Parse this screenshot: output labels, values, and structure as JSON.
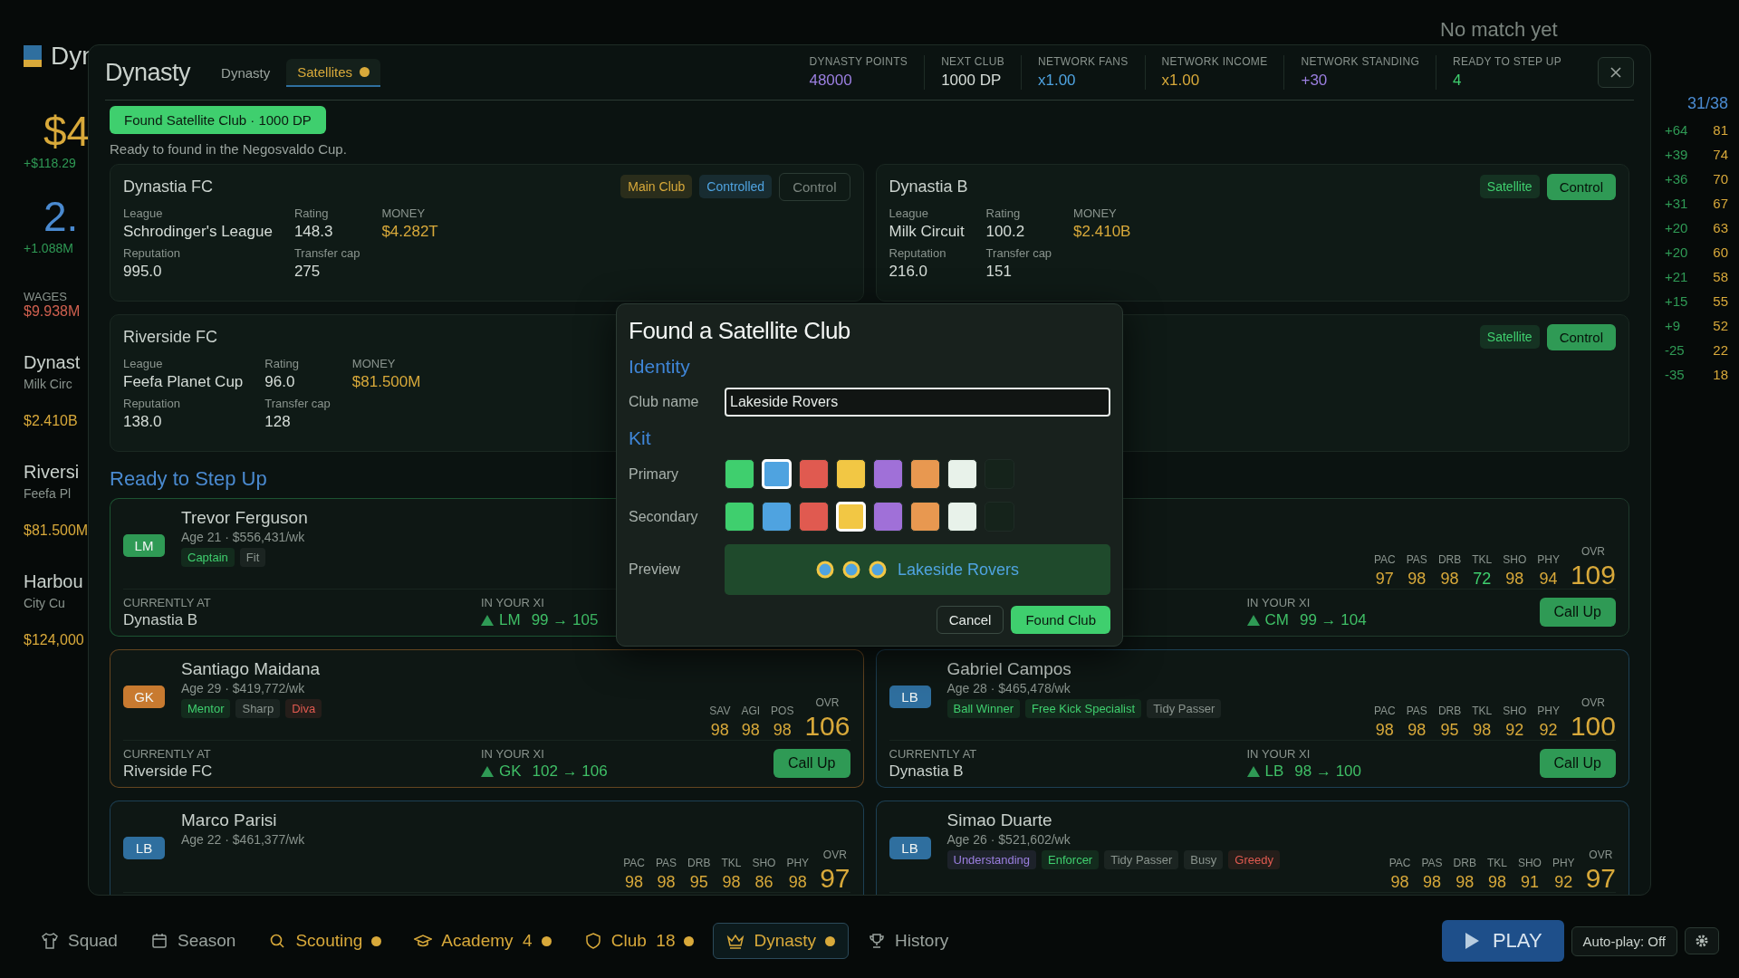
{
  "background": {
    "left": [
      {
        "text": "Dyn",
        "kind": "title"
      },
      {
        "text": "$4",
        "kind": "big",
        "color": "#d8a93a"
      },
      {
        "text": "+$118.29",
        "kind": "small",
        "color": "#2f9a55"
      },
      {
        "text": "2.",
        "kind": "big",
        "color": "#4a8ad0"
      },
      {
        "text": "+1.088M",
        "kind": "small",
        "color": "#2f9a55"
      },
      {
        "text": "WAGES",
        "kind": "label",
        "color": "#8a948e"
      },
      {
        "text": "$9.938M",
        "kind": "money",
        "color": "#d0604f"
      },
      {
        "text": "Dynast",
        "kind": "club",
        "color": "#c9d1cc"
      },
      {
        "text": "Milk Circ",
        "kind": "small",
        "color": "#8a948e"
      },
      {
        "text": "$2.410B",
        "kind": "money",
        "color": "#d8a93a"
      },
      {
        "text": "Riversi",
        "kind": "club",
        "color": "#c9d1cc"
      },
      {
        "text": "Feefa Pl",
        "kind": "small",
        "color": "#8a948e"
      },
      {
        "text": "$81.500M",
        "kind": "money",
        "color": "#d8a93a"
      },
      {
        "text": "Harbou",
        "kind": "club",
        "color": "#c9d1cc"
      },
      {
        "text": "City Cu",
        "kind": "small",
        "color": "#8a948e"
      },
      {
        "text": "$124,000",
        "kind": "money",
        "color": "#d8a93a"
      }
    ],
    "no_match": "No match yet",
    "table_header": "31/38",
    "table_rows": [
      [
        "+64",
        "81"
      ],
      [
        "+39",
        "74"
      ],
      [
        "+36",
        "70"
      ],
      [
        "+31",
        "67"
      ],
      [
        "+20",
        "63"
      ],
      [
        "+20",
        "60"
      ],
      [
        "+21",
        "58"
      ],
      [
        "+15",
        "55"
      ],
      [
        "+9",
        "52"
      ],
      [
        "-25",
        "22"
      ],
      [
        "-35",
        "18"
      ]
    ]
  },
  "panel": {
    "title": "Dynasty",
    "tabs": [
      {
        "label": "Dynasty",
        "selected": false,
        "dot": false
      },
      {
        "label": "Satellites",
        "selected": true,
        "dot": true
      }
    ],
    "stats": [
      {
        "label": "DYNASTY POINTS",
        "value": "48000",
        "color": "#9b7fe0"
      },
      {
        "label": "NEXT CLUB",
        "value": "1000 DP",
        "color": "#d6ddd8"
      },
      {
        "label": "NETWORK FANS",
        "value": "x1.00",
        "color": "#4fa3e0"
      },
      {
        "label": "NETWORK INCOME",
        "value": "x1.00",
        "color": "#d8a93a"
      },
      {
        "label": "NETWORK STANDING",
        "value": "+30",
        "color": "#9b7fe0"
      },
      {
        "label": "READY TO STEP UP",
        "value": "4",
        "color": "#3fcf6e"
      }
    ],
    "found_button": "Found Satellite Club · 1000 DP",
    "status": "Ready to found in the Negosvaldo Cup.",
    "clubs": [
      {
        "name": "Dynastia FC",
        "badges": [
          {
            "label": "Main Club",
            "color": "#d8a93a"
          },
          {
            "label": "Controlled",
            "color": "#4fa3e0"
          }
        ],
        "control": {
          "label": "Control",
          "disabled": true
        },
        "fields": [
          {
            "label": "League",
            "value": "Schrodinger's League",
            "kind": "plain"
          },
          {
            "label": "Rating",
            "value": "148.3",
            "kind": "plain"
          },
          {
            "label": "MONEY",
            "value": "$4.282T",
            "kind": "money"
          },
          {
            "label": "Reputation",
            "value": "995.0",
            "kind": "plain"
          },
          {
            "label": "Transfer cap",
            "value": "275",
            "kind": "plain"
          }
        ]
      },
      {
        "name": "Dynastia B",
        "badges": [
          {
            "label": "Satellite",
            "color": "#3fcf6e"
          }
        ],
        "control": {
          "label": "Control",
          "disabled": false
        },
        "fields": [
          {
            "label": "League",
            "value": "Milk Circuit",
            "kind": "plain"
          },
          {
            "label": "Rating",
            "value": "100.2",
            "kind": "plain"
          },
          {
            "label": "MONEY",
            "value": "$2.410B",
            "kind": "money"
          },
          {
            "label": "Reputation",
            "value": "216.0",
            "kind": "plain"
          },
          {
            "label": "Transfer cap",
            "value": "151",
            "kind": "plain"
          }
        ]
      },
      {
        "name": "Riverside FC",
        "fields": [
          {
            "label": "League",
            "value": "Feefa Planet Cup",
            "kind": "plain"
          },
          {
            "label": "Rating",
            "value": "96.0",
            "kind": "plain"
          },
          {
            "label": "MONEY",
            "value": "$81.500M",
            "kind": "money"
          },
          {
            "label": "Reputation",
            "value": "138.0",
            "kind": "plain"
          },
          {
            "label": "Transfer cap",
            "value": "128",
            "kind": "plain"
          }
        ]
      },
      {
        "badges": [
          {
            "label": "Satellite",
            "color": "#3fcf6e"
          }
        ],
        "control": {
          "label": "Control",
          "disabled": false
        }
      }
    ],
    "step_up_title": "Ready to Step Up",
    "players": [
      {
        "name": "Trevor Ferguson",
        "position": {
          "label": "LM",
          "color": "#2f9a55"
        },
        "age": "Age 21 · $556,431/wk",
        "tags": [
          {
            "label": "Captain",
            "color": "#3fcf6e"
          },
          {
            "label": "Fit",
            "color": "#8a948e"
          }
        ],
        "current": {
          "label": "CURRENTLY AT",
          "value": "Dynastia B"
        },
        "xi": {
          "label": "IN YOUR XI",
          "position": "LM",
          "change": "99 → 105"
        }
      },
      {
        "stats": [
          {
            "label": "PAC",
            "value": "97",
            "color": "#d8a93a"
          },
          {
            "label": "PAS",
            "value": "98",
            "color": "#d8a93a"
          },
          {
            "label": "DRB",
            "value": "98",
            "color": "#d8a93a"
          },
          {
            "label": "TKL",
            "value": "72",
            "color": "#3fcf6e"
          },
          {
            "label": "SHO",
            "value": "98",
            "color": "#d8a93a"
          },
          {
            "label": "PHY",
            "value": "94",
            "color": "#d8a93a"
          }
        ],
        "overall": {
          "label": "OVR",
          "value": "109"
        },
        "xi": {
          "label": "IN YOUR XI",
          "position": "CM",
          "change": "99 → 104"
        },
        "call_up": "Call Up"
      },
      {
        "name": "Santiago Maidana",
        "position": {
          "label": "GK",
          "color": "#c87a30"
        },
        "age": "Age 29 · $419,772/wk",
        "tags": [
          {
            "label": "Mentor",
            "color": "#3fcf6e"
          },
          {
            "label": "Sharp",
            "color": "#8a948e"
          },
          {
            "label": "Diva",
            "color": "#e05a50"
          }
        ],
        "stats": [
          {
            "label": "SAV",
            "value": "98",
            "color": "#d8a93a"
          },
          {
            "label": "AGI",
            "value": "98",
            "color": "#d8a93a"
          },
          {
            "label": "POS",
            "value": "98",
            "color": "#d8a93a"
          }
        ],
        "overall": {
          "label": "OVR",
          "value": "106"
        },
        "current": {
          "label": "CURRENTLY AT",
          "value": "Riverside FC"
        },
        "xi": {
          "label": "IN YOUR XI",
          "position": "GK",
          "change": "102 → 106"
        },
        "call_up": "Call Up"
      },
      {
        "name": "Gabriel Campos",
        "position": {
          "label": "LB",
          "color": "#2f6f9f"
        },
        "age": "Age 28 · $465,478/wk",
        "tags": [
          {
            "label": "Ball Winner",
            "color": "#3fcf6e"
          },
          {
            "label": "Free Kick Specialist",
            "color": "#3fcf6e"
          },
          {
            "label": "Tidy Passer",
            "color": "#8a948e"
          }
        ],
        "stats": [
          {
            "label": "PAC",
            "value": "98",
            "color": "#d8a93a"
          },
          {
            "label": "PAS",
            "value": "98",
            "color": "#d8a93a"
          },
          {
            "label": "DRB",
            "value": "95",
            "color": "#d8a93a"
          },
          {
            "label": "TKL",
            "value": "98",
            "color": "#d8a93a"
          },
          {
            "label": "SHO",
            "value": "92",
            "color": "#d8a93a"
          },
          {
            "label": "PHY",
            "value": "92",
            "color": "#d8a93a"
          }
        ],
        "overall": {
          "label": "OVR",
          "value": "100"
        },
        "current": {
          "label": "CURRENTLY AT",
          "value": "Dynastia B"
        },
        "xi": {
          "label": "IN YOUR XI",
          "position": "LB",
          "change": "98 → 100"
        },
        "call_up": "Call Up"
      },
      {
        "name": "Marco Parisi",
        "position": {
          "label": "LB",
          "color": "#2f6f9f"
        },
        "age": "Age 22 · $461,377/wk",
        "stats": [
          {
            "label": "PAC",
            "value": "98",
            "color": "#d8a93a"
          },
          {
            "label": "PAS",
            "value": "98",
            "color": "#d8a93a"
          },
          {
            "label": "DRB",
            "value": "95",
            "color": "#d8a93a"
          },
          {
            "label": "TKL",
            "value": "98",
            "color": "#d8a93a"
          },
          {
            "label": "SHO",
            "value": "86",
            "color": "#d8a93a"
          },
          {
            "label": "PHY",
            "value": "98",
            "color": "#d8a93a"
          }
        ],
        "overall": {
          "label": "OVR",
          "value": "97"
        }
      },
      {
        "name": "Simao Duarte",
        "position": {
          "label": "LB",
          "color": "#2f6f9f"
        },
        "age": "Age 26 · $521,602/wk",
        "tags": [
          {
            "label": "Understanding",
            "color": "#9b7fe0"
          },
          {
            "label": "Enforcer",
            "color": "#3fcf6e"
          },
          {
            "label": "Tidy Passer",
            "color": "#8a948e"
          },
          {
            "label": "Busy",
            "color": "#8a948e"
          },
          {
            "label": "Greedy",
            "color": "#e05a50"
          }
        ],
        "stats": [
          {
            "label": "PAC",
            "value": "98",
            "color": "#d8a93a"
          },
          {
            "label": "PAS",
            "value": "98",
            "color": "#d8a93a"
          },
          {
            "label": "DRB",
            "value": "98",
            "color": "#d8a93a"
          },
          {
            "label": "TKL",
            "value": "98",
            "color": "#d8a93a"
          },
          {
            "label": "SHO",
            "value": "91",
            "color": "#d8a93a"
          },
          {
            "label": "PHY",
            "value": "92",
            "color": "#d8a93a"
          }
        ],
        "overall": {
          "label": "OVR",
          "value": "97"
        }
      }
    ]
  },
  "modal": {
    "title": "Found a Satellite Club",
    "identity_heading": "Identity",
    "name_label": "Club name",
    "name_value": "Lakeside Rovers",
    "kit_heading": "Kit",
    "primary": {
      "label": "Primary",
      "swatches": [
        {
          "color": "#3fcf6e",
          "selected": false
        },
        {
          "color": "#4fa3e0",
          "selected": true
        },
        {
          "color": "#e05a50",
          "selected": false
        },
        {
          "color": "#f2c744",
          "selected": false
        },
        {
          "color": "#a070d8",
          "selected": false
        },
        {
          "color": "#e89850",
          "selected": false
        },
        {
          "color": "#e8f2ea",
          "selected": false
        },
        {
          "color": "#15231b",
          "selected": false
        }
      ]
    },
    "secondary": {
      "label": "Secondary",
      "swatches": [
        {
          "color": "#3fcf6e",
          "selected": false
        },
        {
          "color": "#4fa3e0",
          "selected": false
        },
        {
          "color": "#e05a50",
          "selected": false
        },
        {
          "color": "#f2c744",
          "selected": true
        },
        {
          "color": "#a070d8",
          "selected": false
        },
        {
          "color": "#e89850",
          "selected": false
        },
        {
          "color": "#e8f2ea",
          "selected": false
        },
        {
          "color": "#15231b",
          "selected": false
        }
      ]
    },
    "preview_label": "Preview",
    "preview_name": "Lakeside Rovers",
    "cancel": "Cancel",
    "confirm": "Found Club"
  },
  "nav": {
    "items": [
      {
        "label": "Squad",
        "dot": false,
        "selected": false
      },
      {
        "label": "Season",
        "dot": false,
        "selected": false
      },
      {
        "label": "Scouting",
        "dot": true,
        "selected": false
      },
      {
        "label": "Academy",
        "count": "4",
        "dot": true,
        "selected": false
      },
      {
        "label": "Club",
        "count": "18",
        "dot": true,
        "selected": false
      },
      {
        "label": "Dynasty",
        "dot": true,
        "selected": true
      },
      {
        "label": "History",
        "dot": false,
        "selected": false
      }
    ],
    "play": "PLAY",
    "autoplay": "Auto-play: Off"
  }
}
